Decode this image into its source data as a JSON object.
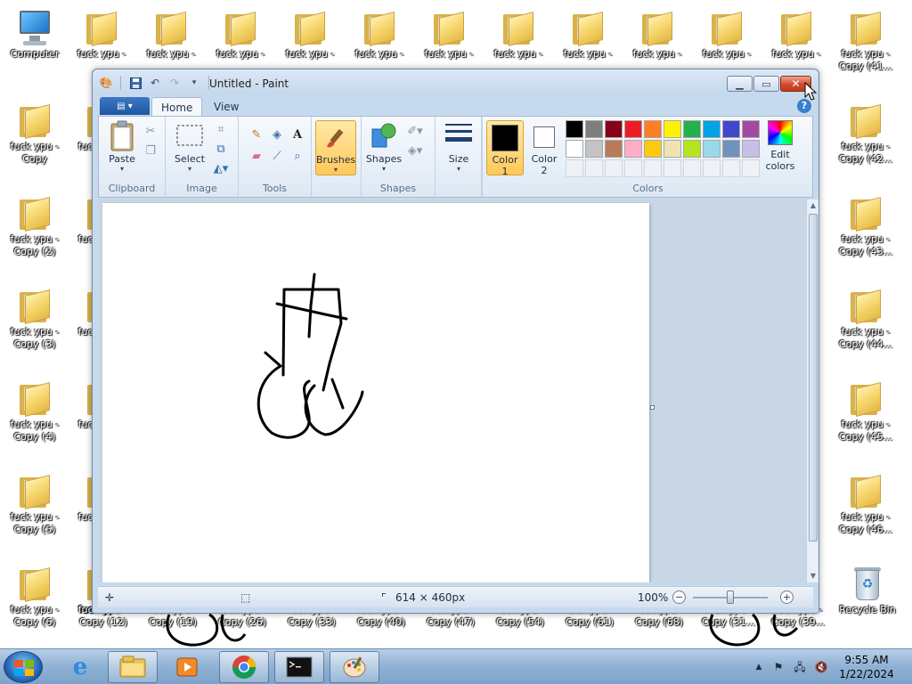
{
  "desktop": {
    "computer_label": "Computer",
    "recycle_label": "Recycle Bin",
    "top_row_label": "fuck ypu -",
    "col1": [
      "fuck ypu -\nCopy",
      "fuck ypu -\nCopy (2)",
      "fuck ypu -\nCopy (3)",
      "fuck ypu -\nCopy (4)",
      "fuck ypu -\nCopy (5)",
      "fuck ypu -\nCopy (6)"
    ],
    "right_col": [
      "fuck ypu -\nCopy (41...",
      "fuck ypu -\nCopy (42...",
      "fuck ypu -\nCopy (43...",
      "fuck ypu -\nCopy (44...",
      "fuck ypu -\nCopy (45...",
      "fuck ypu -\nCopy (46..."
    ],
    "bottom_row": [
      "fuck ypu -\nCopy (12)",
      "fuck ypu -\nCopy (19)",
      "fuck ypu -\nCopy (26)",
      "fuck ypu -\nCopy (33)",
      "fuck ypu -\nCopy (40)",
      "fuck ypu -\nCopy (47)",
      "fuck ypu -\nCopy (54)",
      "fuck ypu -\nCopy (61)",
      "fuck ypu -\nCopy (68)",
      "fuck ypu -\nCopy (31...",
      "fuck ypu -\nCopy (39..."
    ]
  },
  "window": {
    "title": "Untitled - Paint",
    "tabs": {
      "home": "Home",
      "view": "View"
    },
    "help": "?",
    "groups": {
      "clipboard": "Clipboard",
      "image": "Image",
      "tools": "Tools",
      "shapes": "Shapes",
      "colors": "Colors"
    },
    "buttons": {
      "paste": "Paste",
      "select": "Select",
      "brushes": "Brushes",
      "shapes": "Shapes",
      "size": "Size",
      "color1_line1": "Color",
      "color1_line2": "1",
      "color2_line1": "Color",
      "color2_line2": "2",
      "edit_colors_line1": "Edit",
      "edit_colors_line2": "colors"
    },
    "color1": "#000000",
    "color2": "#ffffff",
    "palette": [
      "#000000",
      "#7f7f7f",
      "#880015",
      "#ed1c24",
      "#ff7f27",
      "#fff200",
      "#22b14c",
      "#00a2e8",
      "#3f48cc",
      "#a349a4",
      "#ffffff",
      "#c3c3c3",
      "#b97a57",
      "#ffaec9",
      "#ffc90e",
      "#efe4b0",
      "#b5e61d",
      "#99d9ea",
      "#7092be",
      "#c8bfe7"
    ],
    "status": {
      "canvas_size": "614 × 460px",
      "zoom": "100%"
    }
  },
  "taskbar": {
    "time": "9:55 AM",
    "date": "1/22/2024"
  }
}
